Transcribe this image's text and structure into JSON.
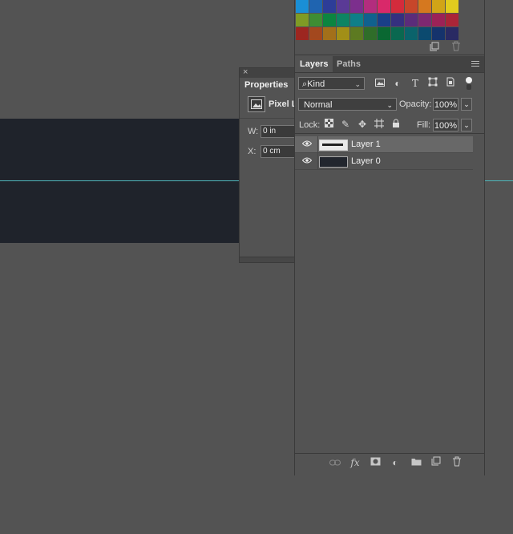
{
  "canvas": {
    "strip_color": "#1f232b",
    "guide_color": "#4fb7bb"
  },
  "properties": {
    "close": "×",
    "title": "Properties",
    "layer_kind": "Pixel Layer",
    "w_label": "W:",
    "w_value": "0 in",
    "x_label": "X:",
    "x_value": "0 cm"
  },
  "swatches": [
    "#1a8fd6",
    "#1f64b0",
    "#2d3d98",
    "#5a3a96",
    "#7c2f8d",
    "#b32d7e",
    "#d9296a",
    "#d42b3c",
    "#c7462a",
    "#d5781f",
    "#d1a417",
    "#e1cc1e",
    "#7f9b25",
    "#3e8d33",
    "#0b8540",
    "#0d8463",
    "#0e7f88",
    "#10618e",
    "#1a3f88",
    "#35307f",
    "#5b2c7a",
    "#7e2871",
    "#9c2257",
    "#aa2538",
    "#9d2620",
    "#a3481e",
    "#a3701a",
    "#a28f17",
    "#5d7a21",
    "#2f6d29",
    "#0a6832",
    "#0a6850",
    "#0a636b",
    "#0b4a6f",
    "#15336c",
    "#292a63"
  ],
  "tabs": {
    "layers": "Layers",
    "paths": "Paths"
  },
  "filter": {
    "kind": "Kind",
    "kind_icon": "search-icon"
  },
  "blend": {
    "mode": "Normal",
    "opacity_label": "Opacity:",
    "opacity": "100%"
  },
  "lock": {
    "label": "Lock:",
    "fill_label": "Fill:",
    "fill": "100%"
  },
  "layers": [
    {
      "name": "Layer 1",
      "selected": true
    },
    {
      "name": "Layer 0",
      "selected": false
    }
  ]
}
